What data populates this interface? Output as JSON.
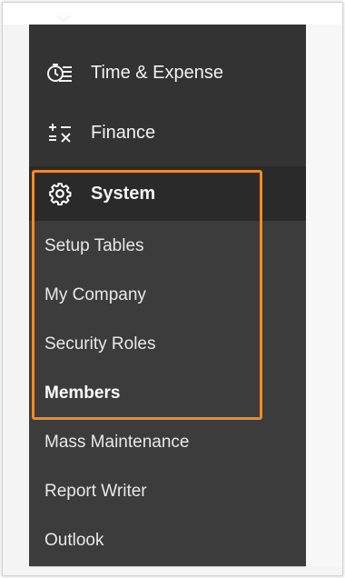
{
  "nav": {
    "items": [
      {
        "label": "Time & Expense",
        "icon": "time-expense-icon"
      },
      {
        "label": "Finance",
        "icon": "finance-icon"
      },
      {
        "label": "System",
        "icon": "gear-icon",
        "active": true
      }
    ]
  },
  "submenu": {
    "items": [
      {
        "label": "Setup Tables"
      },
      {
        "label": "My Company"
      },
      {
        "label": "Security Roles"
      },
      {
        "label": "Members",
        "current": true
      },
      {
        "label": "Mass Maintenance"
      },
      {
        "label": "Report Writer"
      },
      {
        "label": "Outlook"
      }
    ]
  },
  "colors": {
    "sidebar": "#333333",
    "submenu": "#3c3c3c",
    "active_item": "#2a2a2a",
    "highlight": "#f28a24",
    "text": "#f2f2f2"
  }
}
